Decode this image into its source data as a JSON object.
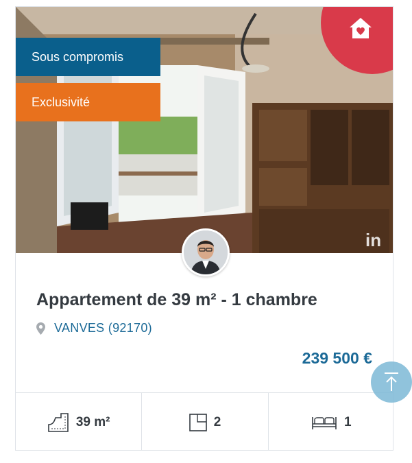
{
  "listing": {
    "badges": {
      "status": "Sous compromis",
      "exclusive": "Exclusivité"
    },
    "title": "Appartement de 39 m² - 1 chambre",
    "location": "VANVES (92170)",
    "price": "239 500 €",
    "features": {
      "area": "39 m²",
      "rooms": "2",
      "bedrooms": "1"
    },
    "photo_watermark": "in"
  },
  "icons": {
    "favorite": "house-heart-icon",
    "location": "map-pin-icon",
    "area": "floor-plan-icon",
    "rooms": "room-square-icon",
    "bedrooms": "bed-icon",
    "scroll_top": "arrow-up-icon"
  },
  "colors": {
    "status_badge": "#0a5f8c",
    "exclusive_badge": "#e8711d",
    "favorite_corner": "#d93a4a",
    "accent_text": "#1c6a97",
    "title_text": "#343a40"
  }
}
